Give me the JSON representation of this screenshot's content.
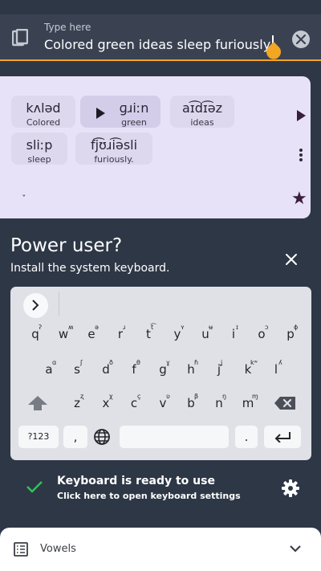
{
  "input": {
    "hint": "Type here",
    "value": "Colored green ideas sleep furiously."
  },
  "card": {
    "words": [
      {
        "ipa": "kʌləd",
        "gloss": "Colored"
      },
      {
        "ipa": "ɡɹiːn",
        "gloss": "green"
      },
      {
        "ipa": "aɪ͡dɪ͡əz",
        "gloss": "ideas"
      },
      {
        "ipa": "sliːp",
        "gloss": "sleep"
      },
      {
        "ipa": "fj͡ʊɹi͡əsli",
        "gloss": "furiously."
      }
    ],
    "collapse_glyph": "ˇ"
  },
  "power": {
    "title": "Power user?",
    "subtitle": "Install the system keyboard."
  },
  "keyboard": {
    "row1": [
      {
        "main": "q",
        "sup": "ʔ"
      },
      {
        "main": "w",
        "sup": "ʍ"
      },
      {
        "main": "e",
        "sup": "ə"
      },
      {
        "main": "r",
        "sup": "ɹ"
      },
      {
        "main": "t",
        "sup": "t͡"
      },
      {
        "main": "y",
        "sup": "ʏ"
      },
      {
        "main": "u",
        "sup": "ʉ"
      },
      {
        "main": "i",
        "sup": "ɪ"
      },
      {
        "main": "o",
        "sup": "ɔ"
      },
      {
        "main": "p",
        "sup": "ɸ"
      }
    ],
    "row2": [
      {
        "main": "a",
        "sup": "ɑ"
      },
      {
        "main": "s",
        "sup": "ʃ"
      },
      {
        "main": "d",
        "sup": "ð"
      },
      {
        "main": "f",
        "sup": "θ"
      },
      {
        "main": "g",
        "sup": "ɣ"
      },
      {
        "main": "h",
        "sup": "ɦ"
      },
      {
        "main": "j",
        "sup": "ʝ"
      },
      {
        "main": "k",
        "sup": "kʷ"
      },
      {
        "main": "l",
        "sup": "ʎ"
      }
    ],
    "row3": [
      {
        "main": "z",
        "sup": "ʐ"
      },
      {
        "main": "x",
        "sup": "χ"
      },
      {
        "main": "c",
        "sup": "ç"
      },
      {
        "main": "v",
        "sup": "ʋ"
      },
      {
        "main": "b",
        "sup": "β"
      },
      {
        "main": "n",
        "sup": "ŋ"
      },
      {
        "main": "m",
        "sup": "ɱ"
      }
    ],
    "num_label": "?123",
    "comma": ",",
    "period": "."
  },
  "ready": {
    "title": "Keyboard is ready to use",
    "subtitle": "Click here to open keyboard settings"
  },
  "sheet": {
    "label": "Vowels"
  },
  "colors": {
    "accent": "#f2a622",
    "check": "#2fc457",
    "star": "#3a1e3c"
  }
}
